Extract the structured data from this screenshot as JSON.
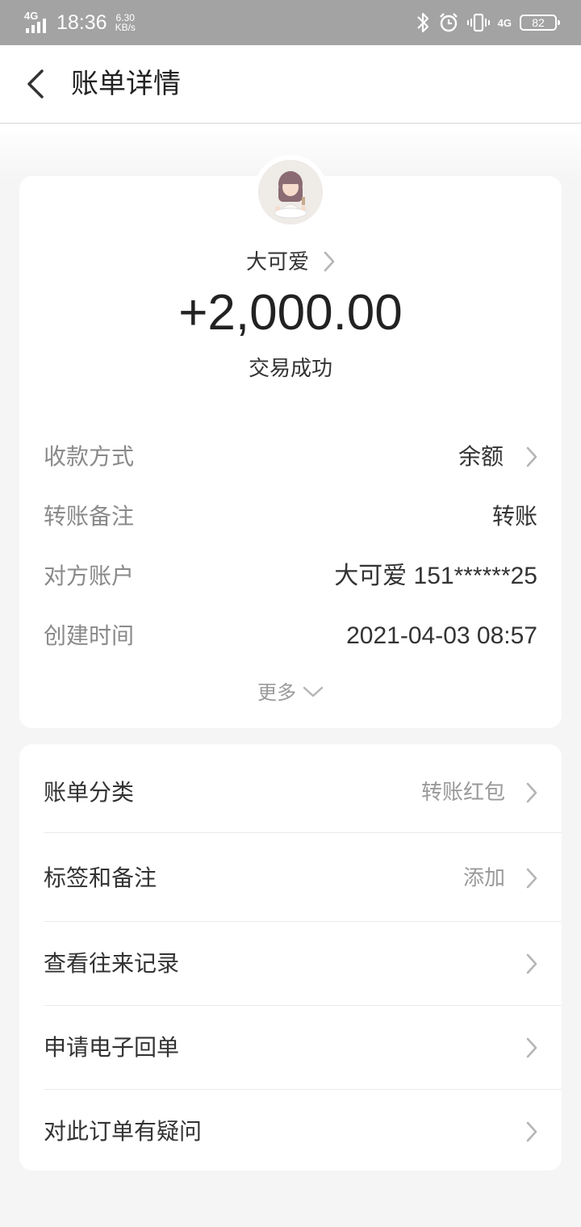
{
  "status_bar": {
    "network_left": "4G",
    "time": "18:36",
    "speed_value": "6.30",
    "speed_unit": "KB/s",
    "network_right": "4G",
    "battery": "82"
  },
  "header": {
    "title": "账单详情"
  },
  "transaction": {
    "payee_name": "大可爱",
    "amount": "+2,000.00",
    "status": "交易成功"
  },
  "details": [
    {
      "label": "收款方式",
      "value": "余额"
    },
    {
      "label": "转账备注",
      "value": "转账"
    },
    {
      "label": "对方账户",
      "value": "大可爱 151******25"
    },
    {
      "label": "创建时间",
      "value": "2021-04-03 08:57"
    }
  ],
  "more_label": "更多",
  "menu": [
    {
      "label": "账单分类",
      "value": "转账红包"
    },
    {
      "label": "标签和备注",
      "value": "添加"
    },
    {
      "label": "查看往来记录",
      "value": ""
    },
    {
      "label": "申请电子回单",
      "value": ""
    },
    {
      "label": "对此订单有疑问",
      "value": ""
    }
  ],
  "icons": {
    "back": "chevron-left-icon",
    "row_arrow": "chevron-right-icon",
    "more": "chevron-down-icon",
    "bluetooth": "bluetooth-icon",
    "alarm": "alarm-icon",
    "vibrate": "vibrate-icon"
  },
  "colors": {
    "status_bar_bg": "#a3a3a3",
    "page_bg": "#f5f5f5",
    "card_bg": "#ffffff",
    "primary_text": "#333333",
    "secondary_text": "#8a8a8a"
  }
}
